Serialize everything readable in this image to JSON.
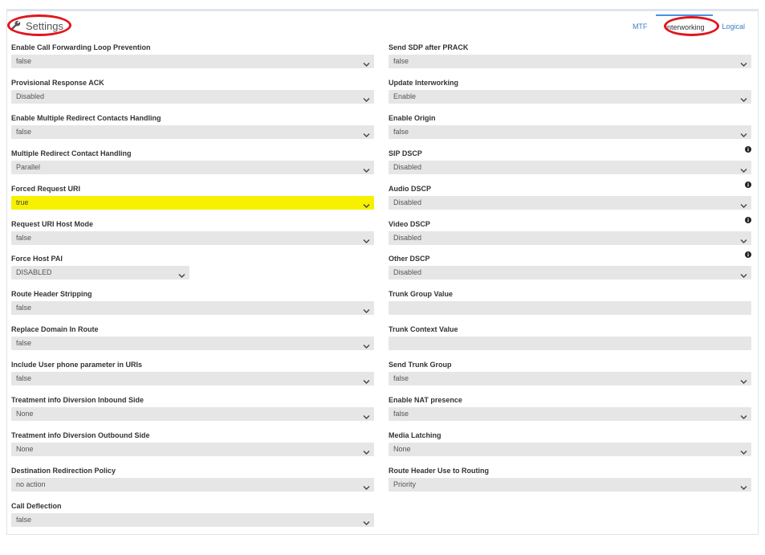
{
  "header": {
    "title": "Settings",
    "title_icon": "wrench-icon"
  },
  "tabs": [
    {
      "label": "MTF",
      "active": false
    },
    {
      "label": "Interworking",
      "active": true
    },
    {
      "label": "Logical",
      "active": false
    }
  ],
  "colors": {
    "highlight": "#f7f100",
    "annotation": "#e0161e",
    "accent": "#3a7cc6"
  },
  "left_fields": [
    {
      "label": "Enable Call Forwarding Loop Prevention",
      "value": "false"
    },
    {
      "label": "Provisional Response ACK",
      "value": "Disabled"
    },
    {
      "label": "Enable Multiple Redirect Contacts Handling",
      "value": "false"
    },
    {
      "label": "Multiple Redirect Contact Handling",
      "value": "Parallel"
    },
    {
      "label": "Forced Request URI",
      "value": "true"
    },
    {
      "label": "Request URI Host Mode",
      "value": "false"
    },
    {
      "label": "Force Host PAI",
      "value": "DISABLED"
    },
    {
      "label": "Route Header Stripping",
      "value": "false"
    },
    {
      "label": "Replace Domain In Route",
      "value": "false"
    },
    {
      "label": "Include User phone parameter in URIs",
      "value": "false"
    },
    {
      "label": "Treatment info Diversion Inbound Side",
      "value": "None"
    },
    {
      "label": "Treatment info Diversion Outbound Side",
      "value": "None"
    },
    {
      "label": "Destination Redirection Policy",
      "value": "no action"
    },
    {
      "label": "Call Deflection",
      "value": "false"
    }
  ],
  "right_fields": [
    {
      "label": "Send SDP after PRACK",
      "value": "false"
    },
    {
      "label": "Update Interworking",
      "value": "Enable"
    },
    {
      "label": "Enable Origin",
      "value": "false"
    },
    {
      "label": "SIP DSCP",
      "value": "Disabled"
    },
    {
      "label": "Audio DSCP",
      "value": "Disabled"
    },
    {
      "label": "Video DSCP",
      "value": "Disabled"
    },
    {
      "label": "Other DSCP",
      "value": "Disabled"
    },
    {
      "label": "Trunk Group Value",
      "value": ""
    },
    {
      "label": "Trunk Context Value",
      "value": ""
    },
    {
      "label": "Send Trunk Group",
      "value": "false"
    },
    {
      "label": "Enable NAT presence",
      "value": "false"
    },
    {
      "label": "Media Latching",
      "value": "None"
    },
    {
      "label": "Route Header Use to Routing",
      "value": "Priority"
    }
  ]
}
